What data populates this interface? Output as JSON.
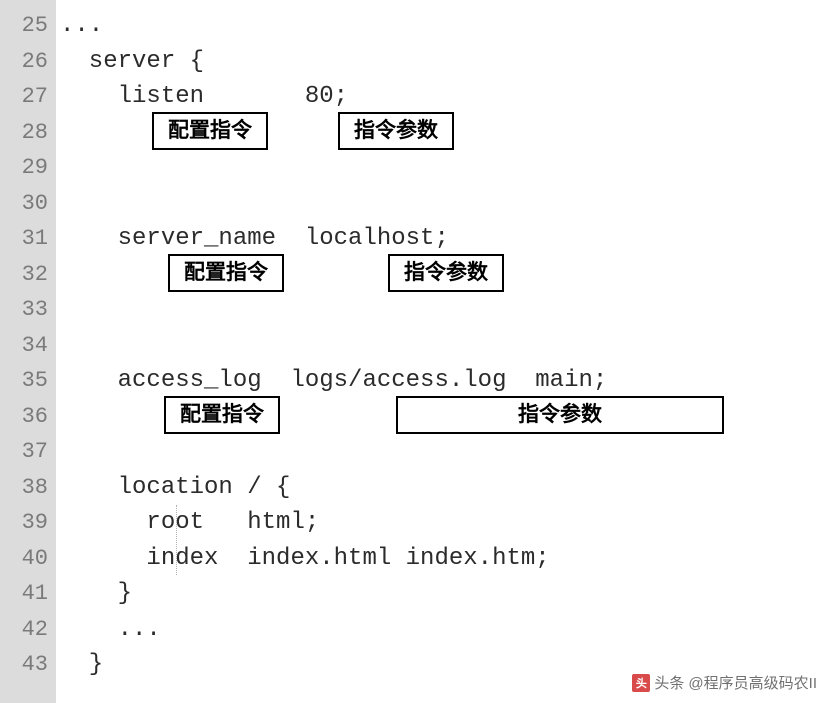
{
  "gutter": {
    "start": 25,
    "end": 43
  },
  "code": {
    "l25": "...",
    "l26": "  server {",
    "l27": "    listen       80;",
    "l28": "",
    "l29": "",
    "l30": "",
    "l31": "    server_name  localhost;",
    "l32": "",
    "l33": "",
    "l34": "",
    "l35": "    access_log  logs/access.log  main;",
    "l36": "",
    "l37": "",
    "l38": "    location / {",
    "l39": "      root   html;",
    "l40": "      index  index.html index.htm;",
    "l41": "    }",
    "l42": "    ...",
    "l43": "  }"
  },
  "annotations": {
    "a1": {
      "left_label": "配置指令",
      "right_label": "指令参数"
    },
    "a2": {
      "left_label": "配置指令",
      "right_label": "指令参数"
    },
    "a3": {
      "left_label": "配置指令",
      "right_label": "指令参数"
    }
  },
  "watermark": {
    "source": "头条",
    "author": "@程序员高级码农II"
  }
}
